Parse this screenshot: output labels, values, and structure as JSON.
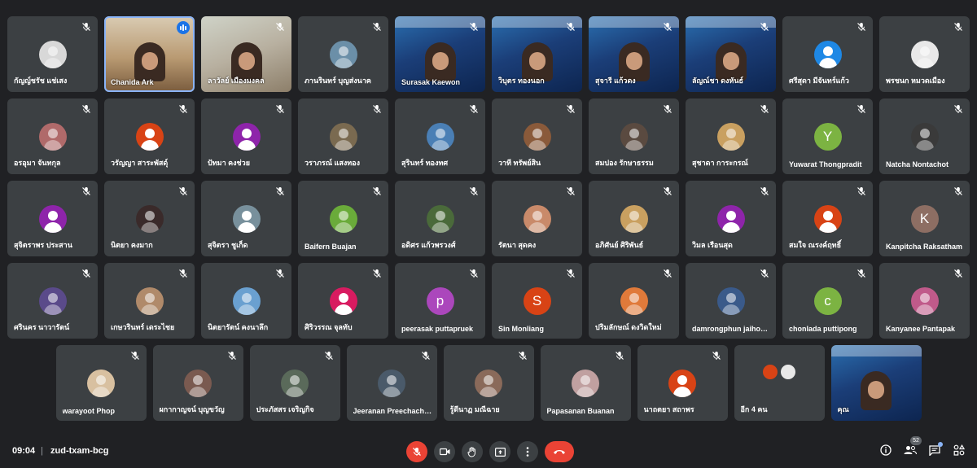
{
  "meeting": {
    "time": "09:04",
    "separator": "|",
    "code": "zud-txam-bcg"
  },
  "colors": {
    "mute_icon": "#ffffff",
    "talking": "#1a73e8",
    "hangup": "#ea4335",
    "tile_bg": "#3c4043",
    "page_bg": "#202124"
  },
  "people_count": "52",
  "rows": [
    [
      {
        "name": "กัญญ์ชรัช แช่เสง",
        "kind": "photo",
        "color": "#d8d8d8"
      },
      {
        "name": "Chanida Ark",
        "kind": "video",
        "scene": "shelf",
        "active": true,
        "talking": true
      },
      {
        "name": "ลาวัลย์ เมืองมงคล",
        "kind": "video",
        "scene": "room"
      },
      {
        "name": "ภานรินทร์ บุญส่งนาค",
        "kind": "photo",
        "color": "#6b8fa8"
      },
      {
        "name": "Surasak Kaewon",
        "kind": "video",
        "scene": "blue"
      },
      {
        "name": "วิบุตร ทองนอก",
        "kind": "video",
        "scene": "blue"
      },
      {
        "name": "สุจารี แก้วดง",
        "kind": "video",
        "scene": "blue"
      },
      {
        "name": "ลัญณ์ชา ดงหันธ์",
        "kind": "video",
        "scene": "blue"
      },
      {
        "name": "ศรีสุดา มีจันทร์แก้ว",
        "kind": "generic",
        "color": "#1e88e5"
      },
      {
        "name": "พรชนก หมวดเมือง",
        "kind": "photo",
        "color": "#e8e8e8"
      }
    ],
    [
      {
        "name": "อรอุมา จันทกุล",
        "kind": "photo",
        "color": "#b06a6a"
      },
      {
        "name": "วรัญญา สาระพัสดุ์",
        "kind": "generic",
        "color": "#d84315"
      },
      {
        "name": "ปัทมา คงช่วย",
        "kind": "generic",
        "color": "#8e24aa"
      },
      {
        "name": "วราภรณ์ แสงทอง",
        "kind": "photo",
        "color": "#7a6a50"
      },
      {
        "name": "สุรินทร์ ทองทศ",
        "kind": "photo",
        "color": "#4a7fb5"
      },
      {
        "name": "วาที ทรัพย์สิน",
        "kind": "photo",
        "color": "#8a5a3a"
      },
      {
        "name": "สมปอง รักษาธรรม",
        "kind": "photo",
        "color": "#5a4a40"
      },
      {
        "name": "สุชาดา การะกรณ์",
        "kind": "photo",
        "color": "#c9a060"
      },
      {
        "name": "Yuwarat Thongpradit",
        "kind": "letter",
        "letter": "Y",
        "color": "#7cb342"
      },
      {
        "name": "Natcha Nontachot",
        "kind": "photo",
        "color": "#3a3a3a"
      }
    ],
    [
      {
        "name": "สุจิตราพร ประสาน",
        "kind": "generic",
        "color": "#8e24aa"
      },
      {
        "name": "นิตยา คงมาก",
        "kind": "photo",
        "color": "#3a2a2a"
      },
      {
        "name": "สุจิตรา ชูเก็ด",
        "kind": "generic",
        "color": "#78909c"
      },
      {
        "name": "Baifern Buajan",
        "kind": "photo",
        "color": "#6aab3a"
      },
      {
        "name": "อดิศร แก้วพรวงศ์",
        "kind": "photo",
        "color": "#4a6a3a"
      },
      {
        "name": "รัตนา สุดคง",
        "kind": "photo",
        "color": "#c98a6a"
      },
      {
        "name": "อภิศันย์ ศิริพันธ์",
        "kind": "photo",
        "color": "#c9a060"
      },
      {
        "name": "วิมล เรือนสุด",
        "kind": "generic",
        "color": "#8e24aa"
      },
      {
        "name": "สมใจ ณรงค์ฤทธิ์",
        "kind": "generic",
        "color": "#d84315"
      },
      {
        "name": "Kanpitcha Raksatham",
        "kind": "letter",
        "letter": "K",
        "color": "#8d6e63"
      }
    ],
    [
      {
        "name": "ศรินคร นาวารัตน์",
        "kind": "photo",
        "color": "#5a4a8a"
      },
      {
        "name": "เกษวรินทร์ เดระไชย",
        "kind": "photo",
        "color": "#b08a6a"
      },
      {
        "name": "นิตยารัตน์ คงนาลึก",
        "kind": "photo",
        "color": "#6aa0d0"
      },
      {
        "name": "ศิริวรรณ จุลทับ",
        "kind": "generic",
        "color": "#d81b60"
      },
      {
        "name": "peerasak puttapruek",
        "kind": "letter",
        "letter": "p",
        "color": "#ab47bc"
      },
      {
        "name": "Sin Monliang",
        "kind": "letter",
        "letter": "S",
        "color": "#d84315"
      },
      {
        "name": "ปริมลักษณ์ ดงวิดใหม่",
        "kind": "photo",
        "color": "#e07a3a"
      },
      {
        "name": "damrongphun jaihow...",
        "kind": "photo",
        "color": "#3a5a8a"
      },
      {
        "name": "chonlada puttipong",
        "kind": "letter",
        "letter": "c",
        "color": "#7cb342"
      },
      {
        "name": "Kanyanee Pantapak",
        "kind": "photo",
        "color": "#c05a8a"
      }
    ],
    [
      {
        "name": "warayoot Phop",
        "kind": "photo",
        "color": "#d8c0a0"
      },
      {
        "name": "ผกากาญจน์ บุญขวัญ",
        "kind": "photo",
        "color": "#7a5a50"
      },
      {
        "name": "ประภัสสร เจริญกิจ",
        "kind": "photo",
        "color": "#5a6a5a"
      },
      {
        "name": "Jeeranan Preechachan",
        "kind": "photo",
        "color": "#4a5a6a"
      },
      {
        "name": "รู้ดีนาฏ มณีฉาย",
        "kind": "photo",
        "color": "#8a6a5a"
      },
      {
        "name": "Papasanan Buanan",
        "kind": "photo",
        "color": "#c0a0a0"
      },
      {
        "name": "นาถตยา สถาพร",
        "kind": "generic",
        "color": "#d84315"
      },
      {
        "name": "อีก 4 คน",
        "kind": "more"
      },
      {
        "name": "คุณ",
        "kind": "video",
        "scene": "blue",
        "nomute": true
      }
    ]
  ]
}
